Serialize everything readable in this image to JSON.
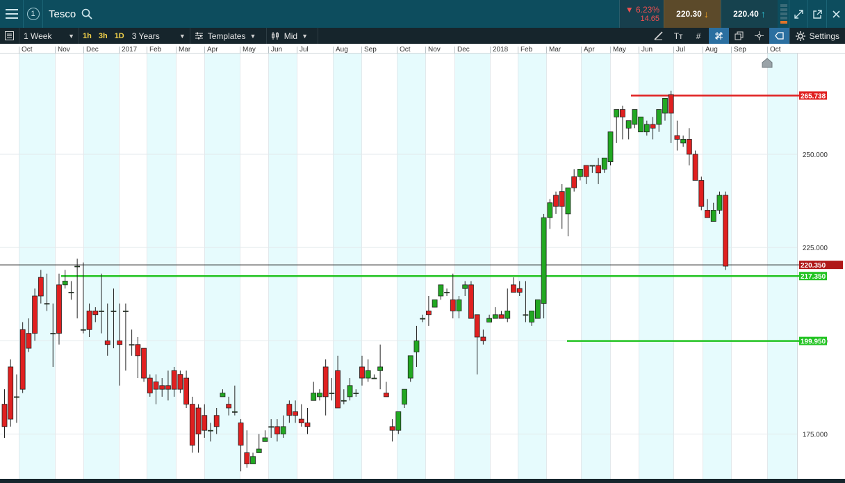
{
  "topbar": {
    "count": "1",
    "instrument": "Tesco",
    "change_pct": "6.23%",
    "change_abs": "14.65",
    "sell_price": "220.30",
    "buy_price": "220.40",
    "change_color": "#f05050"
  },
  "toolbar": {
    "timeframe": "1 Week",
    "intervals": [
      "1h",
      "3h",
      "1D"
    ],
    "range": "3 Years",
    "templates": "Templates",
    "price_type": "Mid",
    "settings": "Settings"
  },
  "chart_data": {
    "type": "candlestick",
    "x_ticks": [
      "Oct",
      "Nov",
      "Dec",
      "2017",
      "Feb",
      "Mar",
      "Apr",
      "May",
      "Jun",
      "Jul",
      "Aug",
      "Sep",
      "Oct",
      "Nov",
      "Dec",
      "2018",
      "Feb",
      "Mar",
      "Apr",
      "May",
      "Jun",
      "Jul",
      "Aug",
      "Sep",
      "Oct"
    ],
    "y_ticks": [
      175,
      200,
      225,
      250
    ],
    "y_tick_labels": [
      "175.000",
      "200.000",
      "225.000",
      "250.000"
    ],
    "ylim": [
      163,
      277
    ],
    "current_price": 220.35,
    "current_price_label": "220.350",
    "levels": [
      {
        "value": 265.738,
        "label": "265.738",
        "color": "#e02020"
      },
      {
        "value": 217.35,
        "label": "217.350",
        "color": "#22c322"
      },
      {
        "value": 199.95,
        "label": "199.950",
        "color": "#22c322"
      }
    ],
    "colors": {
      "up": "#22a822",
      "down": "#e02020",
      "band": "#e6fbfd"
    },
    "ohlc": [
      [
        183,
        187,
        177,
        174
      ],
      [
        193,
        195,
        179,
        177
      ],
      [
        185,
        191,
        185,
        178
      ],
      [
        203,
        205,
        187,
        186
      ],
      [
        202,
        206,
        198,
        197
      ],
      [
        212,
        214,
        202,
        200
      ],
      [
        217,
        219,
        212,
        210
      ],
      [
        210,
        218,
        210,
        208
      ],
      [
        202,
        210,
        202,
        193
      ],
      [
        215,
        218,
        202,
        199
      ],
      [
        215,
        219,
        216,
        214
      ],
      [
        213,
        216,
        213,
        211
      ],
      [
        220,
        222,
        220,
        206
      ],
      [
        203,
        221,
        203,
        202
      ],
      [
        208,
        210,
        203,
        201
      ],
      [
        208,
        209,
        207,
        205
      ],
      [
        208,
        218,
        208,
        202
      ],
      [
        200,
        210,
        199,
        196
      ],
      [
        208,
        214,
        208,
        198
      ],
      [
        200,
        210,
        199,
        188
      ],
      [
        208,
        210,
        208,
        192
      ],
      [
        199,
        203,
        199,
        196
      ],
      [
        199,
        201,
        196,
        190
      ],
      [
        198,
        198,
        190,
        189
      ],
      [
        190,
        191,
        186,
        185
      ],
      [
        189,
        191,
        187,
        183
      ],
      [
        188,
        190,
        187,
        185
      ],
      [
        188,
        192,
        187,
        184
      ],
      [
        192,
        193,
        187,
        185
      ],
      [
        191,
        192,
        187,
        186
      ],
      [
        190,
        192,
        183,
        182
      ],
      [
        183,
        185,
        172,
        170
      ],
      [
        182,
        183,
        175,
        170
      ],
      [
        180,
        183,
        176,
        174
      ],
      [
        176,
        178,
        176,
        173
      ],
      [
        180,
        182,
        177,
        175
      ],
      [
        185,
        187,
        186,
        185
      ],
      [
        183,
        185,
        182,
        180
      ],
      [
        181,
        188,
        181,
        180
      ],
      [
        178,
        179,
        172,
        165
      ],
      [
        170,
        176,
        167,
        166
      ],
      [
        167,
        170,
        169,
        168
      ],
      [
        170,
        175,
        171,
        170
      ],
      [
        173,
        176,
        174,
        173
      ],
      [
        177,
        179,
        177,
        174
      ],
      [
        177,
        179,
        175,
        173
      ],
      [
        175,
        180,
        177,
        174
      ],
      [
        183,
        184,
        180,
        178
      ],
      [
        181,
        184,
        180,
        178
      ],
      [
        179,
        183,
        178,
        177
      ],
      [
        178,
        182,
        177,
        175
      ],
      [
        184,
        189,
        186,
        184
      ],
      [
        185,
        187,
        186,
        184
      ],
      [
        193,
        195,
        185,
        180
      ],
      [
        186,
        190,
        186,
        184
      ],
      [
        192,
        196,
        182,
        182
      ],
      [
        184,
        187,
        184,
        183
      ],
      [
        185,
        190,
        188,
        184
      ],
      [
        186,
        187,
        186,
        185
      ],
      [
        193,
        196,
        190,
        188
      ],
      [
        190,
        195,
        192,
        189
      ],
      [
        190,
        191,
        190,
        190
      ],
      [
        192,
        199,
        193,
        187
      ],
      [
        186,
        189,
        185,
        185
      ],
      [
        177,
        179,
        176,
        173
      ],
      [
        176,
        178,
        181,
        175
      ],
      [
        183,
        186,
        187,
        182
      ],
      [
        190,
        192,
        196,
        189
      ],
      [
        197,
        204,
        200,
        193
      ],
      [
        206,
        207,
        206,
        205
      ],
      [
        208,
        212,
        207,
        204
      ],
      [
        209,
        210,
        211,
        209
      ],
      [
        212,
        214,
        215,
        211
      ],
      [
        213,
        214,
        213,
        212
      ],
      [
        211,
        218,
        208,
        206
      ],
      [
        208,
        212,
        211,
        206
      ],
      [
        214,
        216,
        215,
        212
      ],
      [
        215,
        216,
        206,
        206
      ],
      [
        207,
        207,
        201,
        191
      ],
      [
        201,
        203,
        200,
        199
      ],
      [
        205,
        207,
        206,
        205
      ],
      [
        206,
        209,
        207,
        206
      ],
      [
        207,
        208,
        206,
        206
      ],
      [
        206,
        214,
        208,
        205
      ],
      [
        215,
        217,
        213,
        213
      ],
      [
        214,
        216,
        213,
        212
      ],
      [
        207,
        216,
        207,
        205
      ],
      [
        205,
        208,
        208,
        204
      ],
      [
        206,
        210,
        211,
        206
      ],
      [
        210,
        234,
        233,
        206
      ],
      [
        233,
        238,
        237,
        230
      ],
      [
        239,
        240,
        236,
        234
      ],
      [
        240,
        242,
        236,
        230
      ],
      [
        234,
        241,
        241,
        228
      ],
      [
        244,
        246,
        241,
        240
      ],
      [
        244,
        246,
        246,
        243
      ],
      [
        247,
        247,
        244,
        242
      ],
      [
        247,
        247,
        247,
        245
      ],
      [
        247,
        249,
        245,
        242
      ],
      [
        246,
        249,
        249,
        245
      ],
      [
        248,
        254,
        256,
        247
      ],
      [
        260,
        262,
        262,
        253
      ],
      [
        262,
        263,
        260,
        254
      ],
      [
        257,
        259,
        259,
        254
      ],
      [
        258,
        261,
        262,
        257
      ],
      [
        256,
        260,
        260,
        256
      ],
      [
        256,
        259,
        258,
        255
      ],
      [
        258,
        260,
        257,
        254
      ],
      [
        258,
        262,
        262,
        256
      ],
      [
        261,
        265,
        265,
        259
      ],
      [
        266,
        267,
        261,
        253
      ],
      [
        255,
        259,
        254,
        251
      ],
      [
        253,
        255,
        254,
        252
      ],
      [
        254,
        257,
        250,
        247
      ],
      [
        250,
        251,
        243,
        243
      ],
      [
        243,
        244,
        236,
        235
      ],
      [
        235,
        238,
        233,
        234
      ],
      [
        232,
        237,
        235,
        232
      ],
      [
        235,
        240,
        239,
        234
      ],
      [
        239,
        240,
        220,
        219
      ]
    ]
  }
}
